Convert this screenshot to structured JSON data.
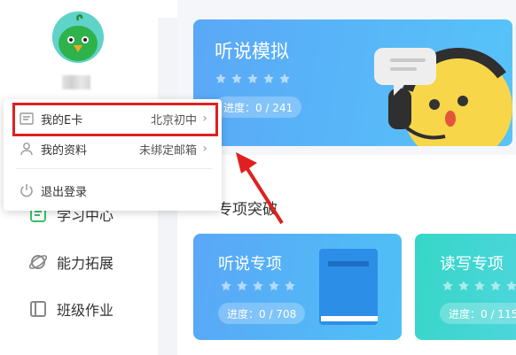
{
  "sidebar": {
    "avatar": "bird-avatar",
    "nav": [
      {
        "label": "学习中心",
        "icon": "book-icon"
      },
      {
        "label": "能力拓展",
        "icon": "planet-icon"
      },
      {
        "label": "班级作业",
        "icon": "clipboard-icon"
      }
    ]
  },
  "popup": {
    "items": [
      {
        "label": "我的E卡",
        "value": "北京初中",
        "icon": "card-icon"
      },
      {
        "label": "我的资料",
        "value": "未绑定邮箱",
        "icon": "user-icon"
      },
      {
        "label": "退出登录",
        "icon": "power-icon"
      }
    ],
    "chevron": "›"
  },
  "banner": {
    "title": "听说模拟",
    "progress": "进度：0 / 241",
    "rating_stars": 5
  },
  "section": {
    "title": "专项突破",
    "cards": [
      {
        "title": "听说专项",
        "progress": "进度：0 / 708",
        "rating_stars": 5
      },
      {
        "title": "读写专项",
        "progress": "进度：0 / 115",
        "rating_stars": 5
      }
    ]
  },
  "colors": {
    "accent_blue": "#5aa8f7",
    "accent_teal": "#36d7c7",
    "highlight_red": "#e02020"
  }
}
